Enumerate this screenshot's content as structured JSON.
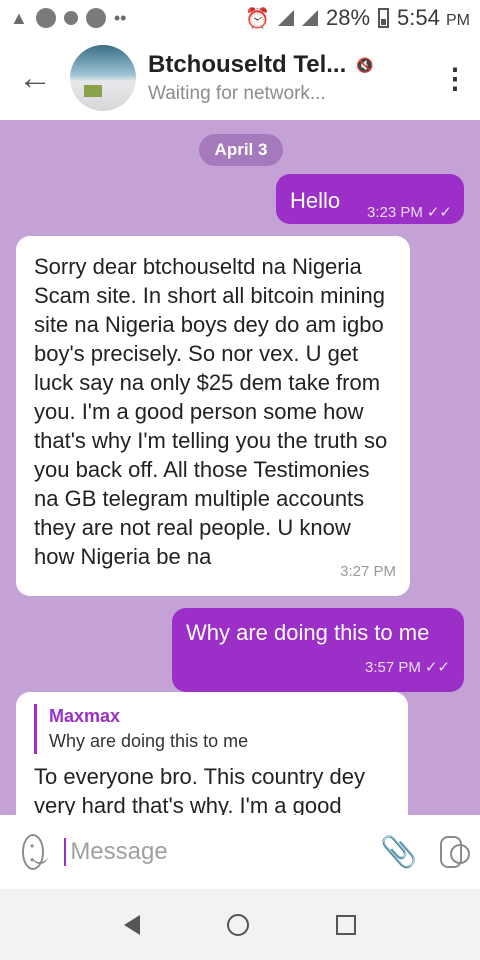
{
  "status_bar": {
    "battery": "28%",
    "time": "5:54",
    "time_suffix": "PM"
  },
  "header": {
    "title": "Btchouseltd Tel...",
    "subtitle": "Waiting for network..."
  },
  "chat": {
    "date_label": "April 3",
    "messages": [
      {
        "direction": "outgoing",
        "text": "Hello",
        "time": "3:23 PM"
      },
      {
        "direction": "incoming",
        "text": "Sorry dear btchouseltd na Nigeria Scam site. In short all bitcoin mining site na Nigeria boys dey do am igbo boy's precisely. So nor vex. U get luck say na only $25 dem take from you. I'm a good person some how that's why I'm telling you the truth so you back off. All those Testimonies na GB telegram multiple accounts they are not real people. U know how Nigeria be na",
        "time": "3:27 PM"
      },
      {
        "direction": "outgoing",
        "text": "Why are doing this to me",
        "time": "3:57 PM"
      },
      {
        "direction": "incoming",
        "reply_name": "Maxmax",
        "reply_text": "Why are doing this to me",
        "text": "To everyone bro. This country dey very hard that's why. I'm a good"
      }
    ]
  },
  "input": {
    "placeholder": "Message"
  },
  "colors": {
    "accent": "#9b2fc8",
    "chat_background": "#c4a2d6",
    "incoming_bubble": "#ffffff"
  },
  "icons": {
    "back": "arrow-left-icon",
    "menu": "more-vertical-icon",
    "attach": "paperclip-icon",
    "camera": "camera-icon",
    "emoji": "smiley-icon"
  }
}
